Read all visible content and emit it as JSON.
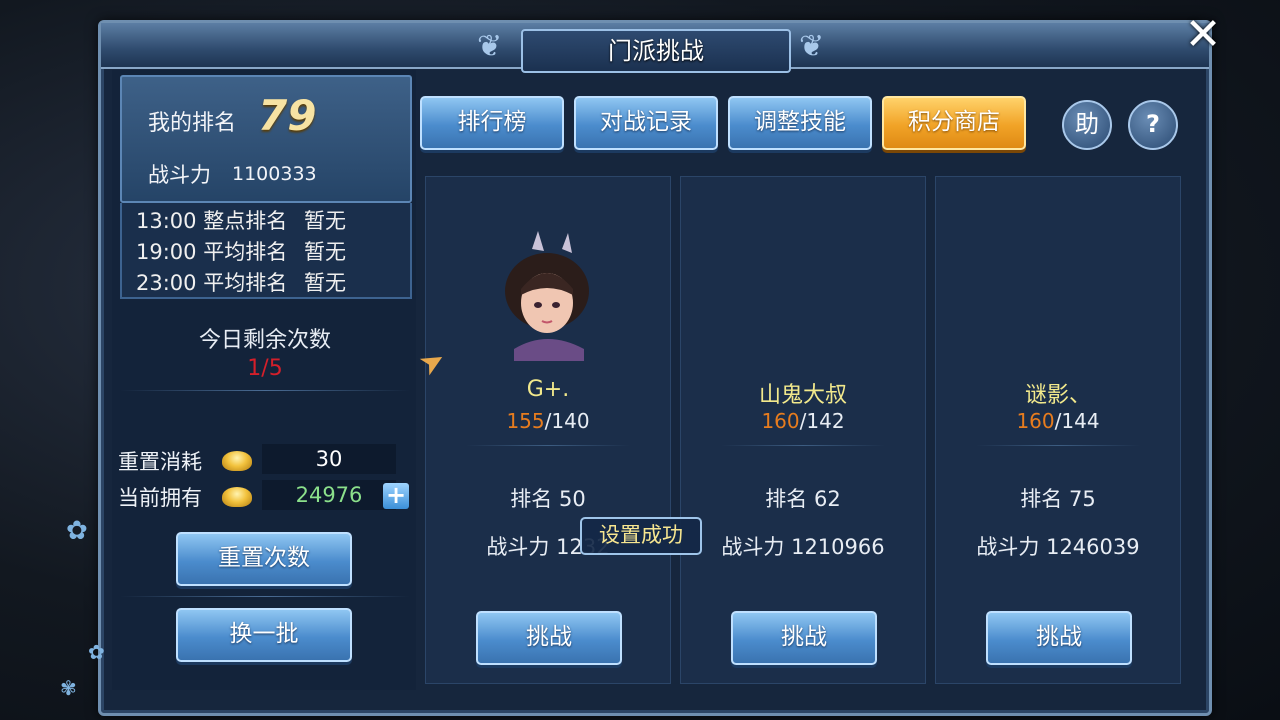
{
  "window": {
    "title": "门派挑战"
  },
  "my_rank": {
    "label": "我的排名",
    "value": "79",
    "power_label": "战斗力",
    "power_value": "1100333"
  },
  "schedule": [
    {
      "time": "13:00",
      "label": "整点排名",
      "pos": "暂无"
    },
    {
      "time": "19:00",
      "label": "平均排名",
      "pos": "暂无"
    },
    {
      "time": "23:00",
      "label": "平均排名",
      "pos": "暂无"
    }
  ],
  "today": {
    "label": "今日剩余次数",
    "value": "1/5"
  },
  "reset_cost": {
    "label": "重置消耗",
    "value": "30"
  },
  "current_owned": {
    "label": "当前拥有",
    "value": "24976"
  },
  "buttons": {
    "reset_count": "重置次数",
    "refresh": "换一批"
  },
  "tabs": [
    {
      "label": "排行榜",
      "active": false
    },
    {
      "label": "对战记录",
      "active": false
    },
    {
      "label": "调整技能",
      "active": false
    },
    {
      "label": "积分商店",
      "active": true
    }
  ],
  "help_button": "助",
  "question_button": "?",
  "opponents": [
    {
      "name": "G+.",
      "level": "155",
      "max_level": "/140",
      "rank_label": "排名",
      "rank": "50",
      "power_label": "战斗力",
      "power": "1232",
      "challenge": "挑战",
      "has_avatar": true
    },
    {
      "name": "山鬼大叔",
      "level": "160",
      "max_level": "/142",
      "rank_label": "排名",
      "rank": "62",
      "power_label": "战斗力",
      "power": "1210966",
      "challenge": "挑战",
      "has_avatar": false
    },
    {
      "name": "谜影、",
      "level": "160",
      "max_level": "/144",
      "rank_label": "排名",
      "rank": "75",
      "power_label": "战斗力",
      "power": "1246039",
      "challenge": "挑战",
      "has_avatar": false
    }
  ],
  "toast": "设置成功",
  "colors": {
    "accent_orange": "#f1a327",
    "level_orange": "#e77c1e",
    "name_yellow": "#f2e98c",
    "alert_red": "#d41f2a"
  },
  "icons": {
    "close": "close-icon",
    "currency": "gold-ingot-icon",
    "add": "plus-icon"
  }
}
